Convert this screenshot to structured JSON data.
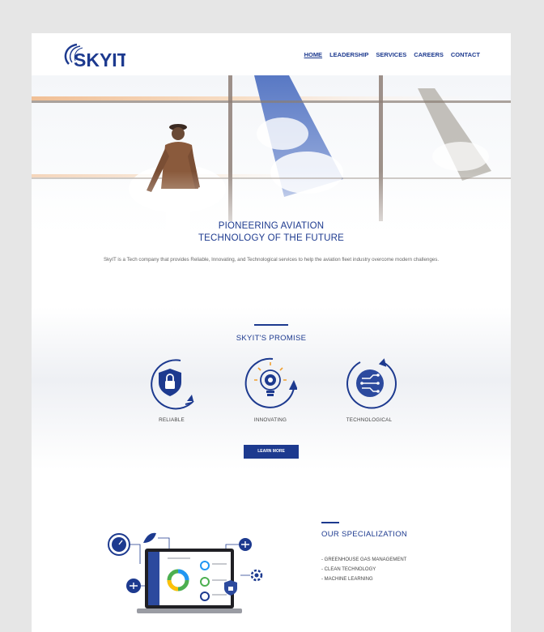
{
  "brand": {
    "logo_text": "SKYIT"
  },
  "nav": {
    "items": [
      {
        "label": "HOME",
        "active": true
      },
      {
        "label": "LEADERSHIP"
      },
      {
        "label": "SERVICES"
      },
      {
        "label": "CAREERS"
      },
      {
        "label": "CONTACT"
      }
    ]
  },
  "hero": {
    "title_line1": "PIONEERING AVIATION",
    "title_line2": "TECHNOLOGY OF THE FUTURE",
    "description": "SkyIT is a Tech company that provides Reliable, Innovating, and Technological services to help the aviation fleet industry overcome modern challenges."
  },
  "promise": {
    "title": "SKYIT'S PROMISE",
    "features": [
      {
        "label": "RELIABLE",
        "icon": "shield-lock-icon"
      },
      {
        "label": "INNOVATING",
        "icon": "lightbulb-gear-icon"
      },
      {
        "label": "TECHNOLOGICAL",
        "icon": "circuit-icon"
      }
    ],
    "cta_label": "LEARN MORE"
  },
  "specialization": {
    "title": "OUR SPECIALIZATION",
    "items": [
      "- GREENHOUSE GAS MANAGEMENT",
      "- CLEAN TECHNOLOGY",
      "- MACHINE LEARNING"
    ]
  },
  "colors": {
    "brand_blue": "#1d3a8f",
    "page_bg": "#e6e6e6"
  }
}
